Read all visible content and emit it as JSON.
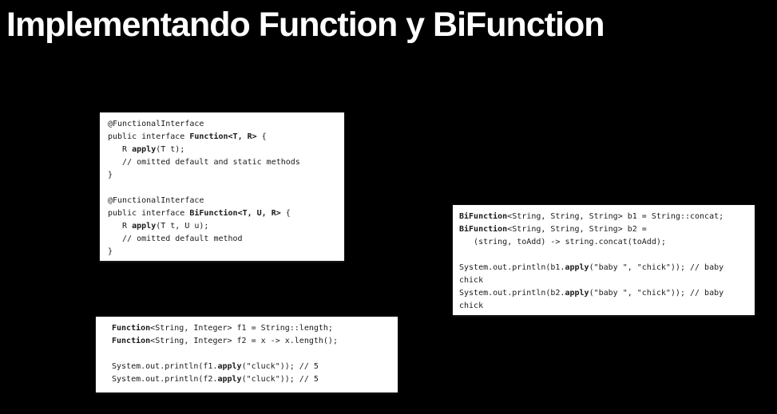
{
  "slide": {
    "title": "Implementando Function y BiFunction"
  },
  "box_interfaces": {
    "l1": "@FunctionalInterface",
    "l2_a": "public interface ",
    "l2_b": "Function<T, R>",
    "l2_c": " {",
    "l3_a": "   R ",
    "l3_b": "apply",
    "l3_c": "(T t);",
    "l4": "   // omitted default and static methods",
    "l5": "}",
    "l6": "@FunctionalInterface",
    "l7_a": "public interface ",
    "l7_b": "BiFunction<T, U, R>",
    "l7_c": " {",
    "l8_a": "   R ",
    "l8_b": "apply",
    "l8_c": "(T t, U u);",
    "l9": "   // omitted default method",
    "l10": "}"
  },
  "box_bifunction": {
    "l1_a": "BiFunction",
    "l1_b": "<String, String, String> b1 = String::concat;",
    "l2_a": "BiFunction",
    "l2_b": "<String, String, String> b2 =",
    "l3": "   (string, toAdd) -> string.concat(toAdd);",
    "l4_a": "System.out.println(b1.",
    "l4_b": "apply",
    "l4_c": "(\"baby \", \"chick\")); // baby",
    "l5": "chick",
    "l6_a": "System.out.println(b2.",
    "l6_b": "apply",
    "l6_c": "(\"baby \", \"chick\")); // baby",
    "l7": "chick"
  },
  "box_function": {
    "l1_a": "Function",
    "l1_b": "<String, Integer> f1 = String::length;",
    "l2_a": "Function",
    "l2_b": "<String, Integer> f2 = x -> x.length();",
    "l3_a": "System.out.println(f1.",
    "l3_b": "apply",
    "l3_c": "(\"cluck\")); // 5",
    "l4_a": "System.out.println(f2.",
    "l4_b": "apply",
    "l4_c": "(\"cluck\")); // 5"
  }
}
